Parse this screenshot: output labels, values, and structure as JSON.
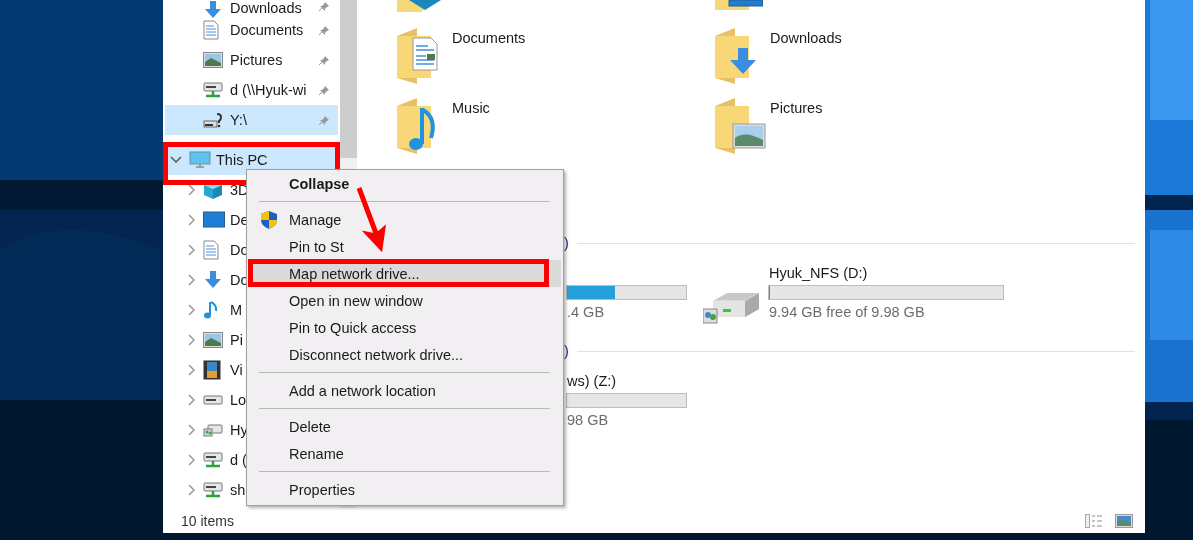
{
  "nav": {
    "items": [
      {
        "label": "Downloads",
        "kind": "download",
        "pinned": true,
        "selected": false
      },
      {
        "label": "Documents",
        "kind": "document",
        "pinned": true,
        "selected": false
      },
      {
        "label": "Pictures",
        "kind": "picture",
        "pinned": true,
        "selected": false
      },
      {
        "label": "d (\\\\Hyuk-wi",
        "kind": "netdrive",
        "pinned": true,
        "selected": false
      },
      {
        "label": "Y:\\",
        "kind": "unknowndrive",
        "pinned": true,
        "selected": true
      },
      {
        "label": "This PC",
        "kind": "pc",
        "selected": true,
        "expanded": true,
        "children": [
          {
            "label": "3D",
            "kind": "cube",
            "expanded": false,
            "selected": false
          },
          {
            "label": "De",
            "kind": "desktop",
            "expanded": false,
            "selected": false
          },
          {
            "label": "Do",
            "kind": "document",
            "expanded": false,
            "selected": false
          },
          {
            "label": "Do",
            "kind": "download",
            "expanded": false,
            "selected": false
          },
          {
            "label": "M",
            "kind": "music",
            "expanded": false,
            "selected": false
          },
          {
            "label": "Pi",
            "kind": "picture",
            "expanded": false,
            "selected": false
          },
          {
            "label": "Vi",
            "kind": "video",
            "expanded": false,
            "selected": false
          },
          {
            "label": "Lo",
            "kind": "disk",
            "expanded": false,
            "selected": false
          },
          {
            "label": "Hy",
            "kind": "shareddisk",
            "expanded": false,
            "selected": false
          },
          {
            "label": "d (",
            "kind": "netdrive",
            "expanded": false,
            "selected": false
          },
          {
            "label": "sh",
            "kind": "netdrive",
            "expanded": false,
            "selected": false
          }
        ]
      }
    ]
  },
  "content": {
    "folders": [
      {
        "kind": "cube"
      },
      {
        "kind": "desktop"
      },
      {
        "label": "Documents",
        "kind": "document"
      },
      {
        "label": "Downloads",
        "kind": "download"
      },
      {
        "label": "Music",
        "kind": "music"
      },
      {
        "label": "Pictures",
        "kind": "picture"
      }
    ],
    "sections": [
      {
        "header": ")",
        "drives": [
          {
            "level": 0.4,
            "space": ".4 GB"
          },
          {
            "label": "Hyuk_NFS (D:)",
            "kind": "shareddisk",
            "level": 0.004,
            "space": "9.94 GB free of 9.98 GB"
          }
        ]
      },
      {
        "header": ")",
        "drives": [
          {
            "label": "ws) (Z:)",
            "space": "98 GB"
          }
        ]
      }
    ]
  },
  "context_menu": {
    "items": [
      {
        "kind": "item",
        "label": "Collapse",
        "bold": true,
        "selected": false
      },
      {
        "kind": "separator"
      },
      {
        "kind": "admin",
        "label": "Manage",
        "bold": false,
        "selected": false
      },
      {
        "kind": "item",
        "label": "Pin to St",
        "bold": false,
        "selected": false
      },
      {
        "kind": "item",
        "label": "Map network drive...",
        "bold": false,
        "selected": true
      },
      {
        "kind": "item",
        "label": "Open in new window",
        "bold": false,
        "selected": false
      },
      {
        "kind": "item",
        "label": "Pin to Quick access",
        "bold": false,
        "selected": false
      },
      {
        "kind": "item",
        "label": "Disconnect network drive...",
        "bold": false,
        "selected": false
      },
      {
        "kind": "separator"
      },
      {
        "kind": "item",
        "label": "Add a network location",
        "bold": false,
        "selected": false
      },
      {
        "kind": "separator"
      },
      {
        "kind": "item",
        "label": "Delete",
        "bold": false,
        "selected": false
      },
      {
        "kind": "item",
        "label": "Rename",
        "bold": false,
        "selected": false
      },
      {
        "kind": "separator"
      },
      {
        "kind": "item",
        "label": "Properties",
        "bold": false,
        "selected": false
      }
    ]
  },
  "status_bar": {
    "item_count": "10 items"
  }
}
